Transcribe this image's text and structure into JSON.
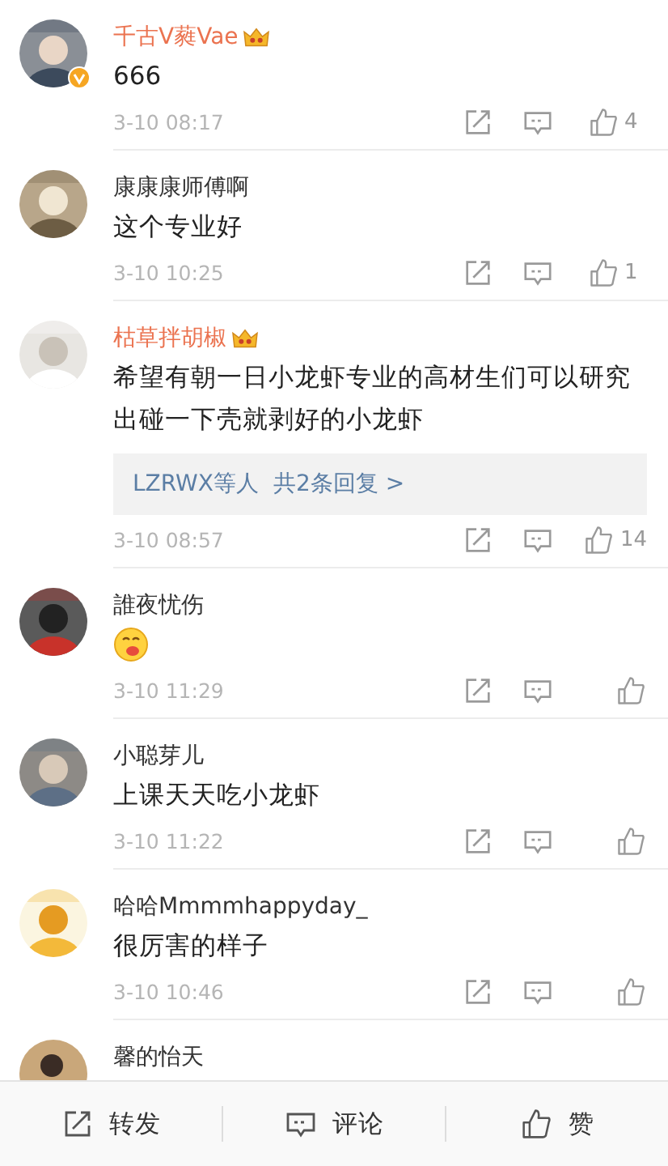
{
  "comments": [
    {
      "name": "千古V蕤Vae",
      "vip": true,
      "verified": true,
      "body": "666",
      "kind": "text",
      "time": "3-10 08:17",
      "likes": "4"
    },
    {
      "name": "康康康师傅啊",
      "vip": false,
      "verified": false,
      "body": "这个专业好",
      "kind": "text",
      "time": "3-10 10:25",
      "likes": "1"
    },
    {
      "name": "枯草拌胡椒",
      "vip": true,
      "verified": false,
      "body": "希望有朝一日小龙虾专业的高材生们可以研究出碰一下壳就剥好的小龙虾",
      "kind": "text",
      "replies": {
        "who": "LZRWX等人",
        "count": "共2条回复 >"
      },
      "time": "3-10 08:57",
      "likes": "14"
    },
    {
      "name": "誰夜忧伤",
      "vip": false,
      "verified": false,
      "kind": "emoji",
      "time": "3-10 11:29"
    },
    {
      "name": "小聪芽儿",
      "vip": false,
      "verified": false,
      "body": "上课天天吃小龙虾",
      "kind": "text",
      "time": "3-10 11:22"
    },
    {
      "name": "哈哈Mmmmhappyday_",
      "vip": false,
      "verified": false,
      "body": "很厉害的样子",
      "kind": "text",
      "time": "3-10 10:46"
    }
  ],
  "partial_comment": {
    "name": "馨的怡天"
  },
  "bottom_bar": [
    "转发",
    "评论",
    "赞"
  ]
}
